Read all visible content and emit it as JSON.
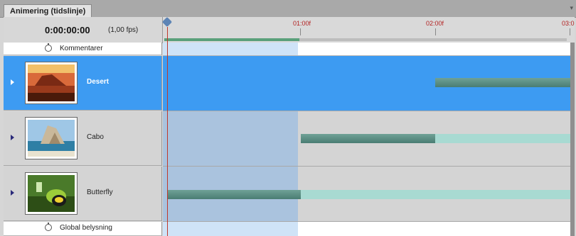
{
  "tab": {
    "title": "Animering (tidslinje)"
  },
  "header": {
    "time": "0:00:00:00",
    "fps": "(1,00 fps)"
  },
  "ruler": {
    "labels": [
      {
        "text": "01:00f"
      },
      {
        "text": "02:00f"
      },
      {
        "text": "03:0"
      }
    ]
  },
  "rows": {
    "comments": {
      "label": "Kommentarer"
    },
    "layers": [
      {
        "name": "Desert",
        "selected": true,
        "thumb_icon": "desert-thumbnail"
      },
      {
        "name": "Cabo",
        "selected": false,
        "thumb_icon": "cabo-thumbnail"
      },
      {
        "name": "Butterfly",
        "selected": false,
        "thumb_icon": "butterfly-thumbnail"
      }
    ],
    "global": {
      "label": "Global belysning"
    }
  }
}
